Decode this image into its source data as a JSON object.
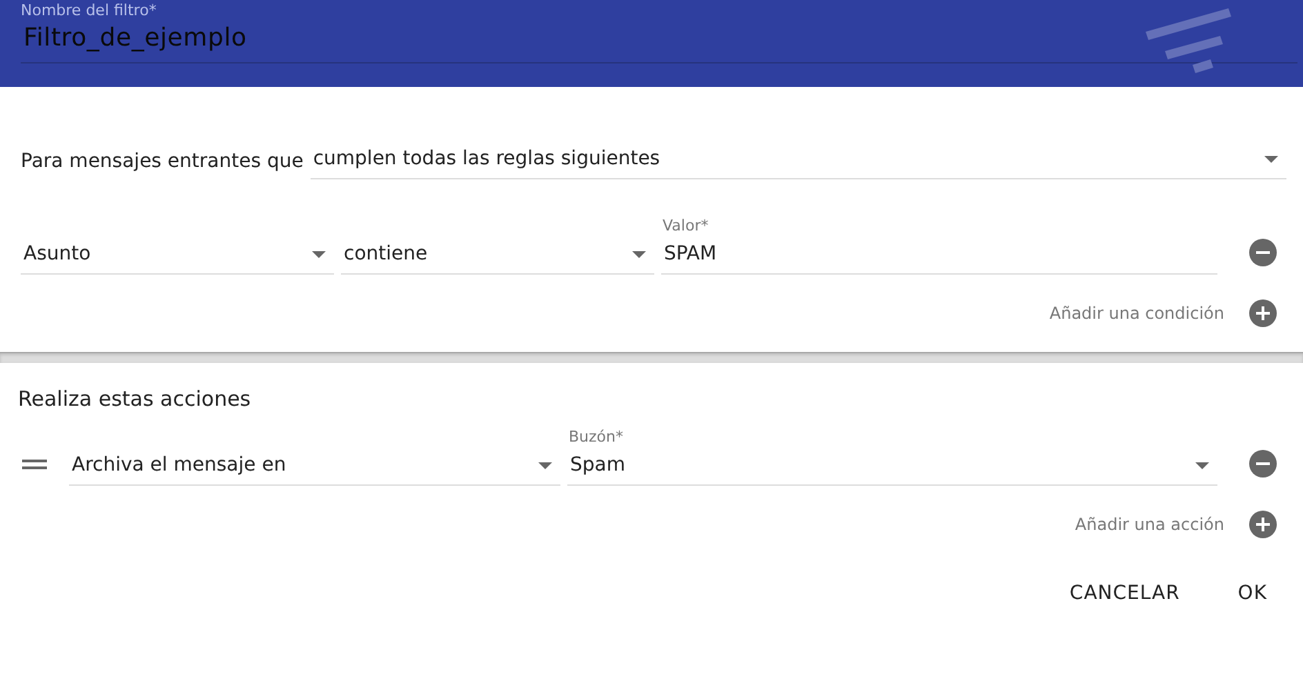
{
  "header": {
    "name_field": {
      "label": "Nombre del filtro*",
      "value": "Filtro_de_ejemplo"
    }
  },
  "match": {
    "label": "Para mensajes entrantes que",
    "value": "cumplen todas las reglas siguientes"
  },
  "conditions": [
    {
      "field": "Asunto",
      "operator": "contiene",
      "value_label": "Valor*",
      "value": "SPAM"
    }
  ],
  "add_condition": "Añadir una condición",
  "actions_title": "Realiza estas acciones",
  "actions": [
    {
      "action": "Archiva el mensaje en",
      "target_label": "Buzón*",
      "target": "Spam"
    }
  ],
  "add_action": "Añadir una acción",
  "buttons": [
    {
      "label": "CANCELAR"
    },
    {
      "label": "OK"
    }
  ]
}
